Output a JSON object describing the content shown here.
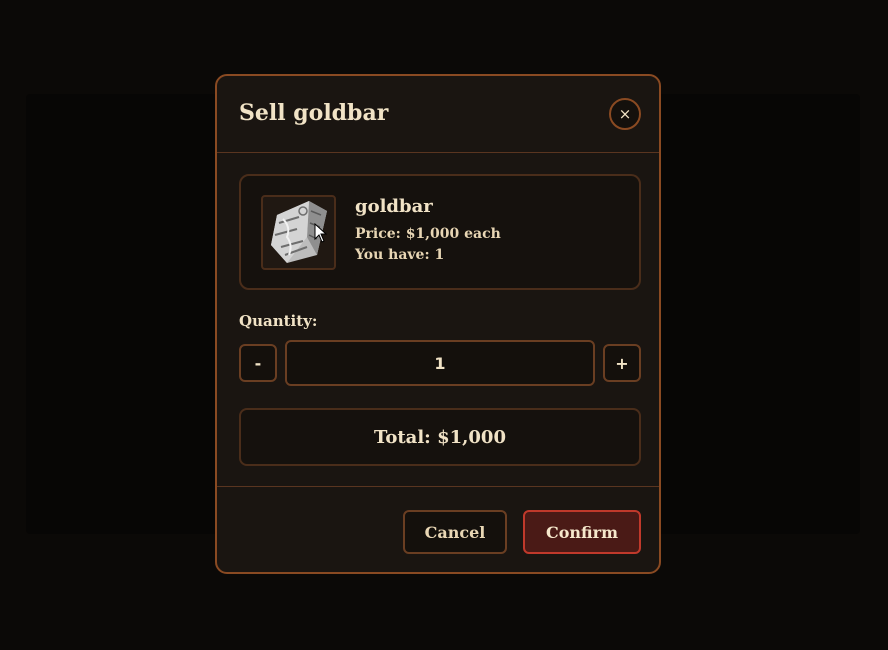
{
  "dialog": {
    "title": "Sell goldbar",
    "close_glyph": "×"
  },
  "item": {
    "name": "goldbar",
    "price_text": "Price: $1,000 each",
    "owned_text": "You have: 1",
    "icon": "goldbar-image"
  },
  "quantity": {
    "label": "Quantity:",
    "decrement_label": "-",
    "increment_label": "+",
    "value": "1"
  },
  "total": {
    "text": "Total: $1,000"
  },
  "actions": {
    "cancel_label": "Cancel",
    "confirm_label": "Confirm"
  },
  "colors": {
    "accent_border": "#8a4a22",
    "confirm_border": "#c0392b",
    "text": "#f1e3c6"
  }
}
